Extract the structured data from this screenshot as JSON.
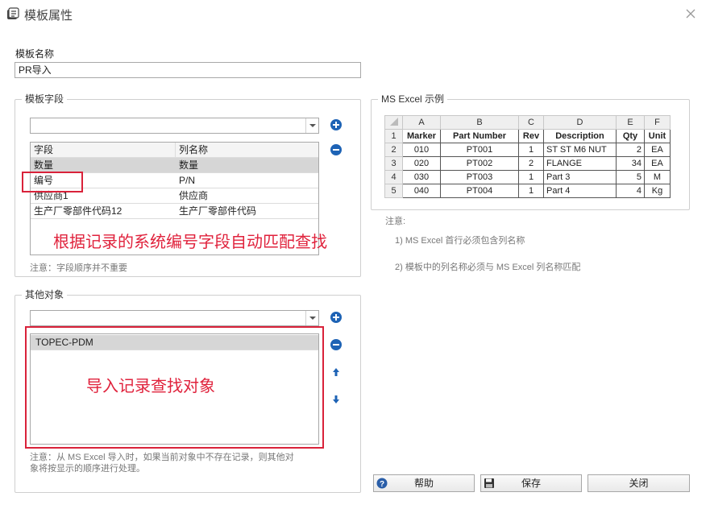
{
  "window": {
    "title": "模板属性"
  },
  "template_name": {
    "label": "模板名称",
    "value": "PR导入"
  },
  "template_fields": {
    "group_title": "模板字段",
    "combo_value": "",
    "columns": [
      "字段",
      "列名称"
    ],
    "rows": [
      {
        "field": "数量",
        "column": "数量"
      },
      {
        "field": "编号",
        "column": "P/N"
      },
      {
        "field": "供应商1",
        "column": "供应商"
      },
      {
        "field": "生产厂零部件代码12",
        "column": "生产厂零部件代码"
      }
    ],
    "note": "注意：字段顺序并不重要",
    "annotation": "根据记录的系统编号字段自动匹配查找"
  },
  "other_objects": {
    "group_title": "其他对象",
    "combo_value": "",
    "items": [
      "TOPEC-PDM"
    ],
    "annotation": "导入记录查找对象",
    "note_line1": "注意：从 MS Excel 导入时，如果当前对象中不存在记录，则其他对",
    "note_line2": "象将按显示的顺序进行处理。"
  },
  "excel_example": {
    "group_title": "MS Excel 示例",
    "col_letters": [
      "A",
      "B",
      "C",
      "D",
      "E",
      "F"
    ],
    "headers": [
      "Marker",
      "Part Number",
      "Rev",
      "Description",
      "Qty",
      "Unit"
    ],
    "rows": [
      [
        "010",
        "PT001",
        "1",
        "ST ST M6 NUT",
        "2",
        "EA"
      ],
      [
        "020",
        "PT002",
        "2",
        "FLANGE",
        "34",
        "EA"
      ],
      [
        "030",
        "PT003",
        "1",
        "Part 3",
        "5",
        "M"
      ],
      [
        "040",
        "PT004",
        "1",
        "Part 4",
        "4",
        "Kg"
      ]
    ],
    "row_numbers": [
      "1",
      "2",
      "3",
      "4",
      "5"
    ]
  },
  "notes": {
    "title": "注意:",
    "line1": "1) MS Excel 首行必须包含列名称",
    "line2": "2) 模板中的列名称必须与 MS Excel 列名称匹配"
  },
  "buttons": {
    "help": "帮助",
    "save": "保存",
    "close": "关闭"
  },
  "colors": {
    "accent_blue": "#1e63b5",
    "annotation_red": "#e0223c",
    "selection_gray": "#d6d6d6"
  }
}
